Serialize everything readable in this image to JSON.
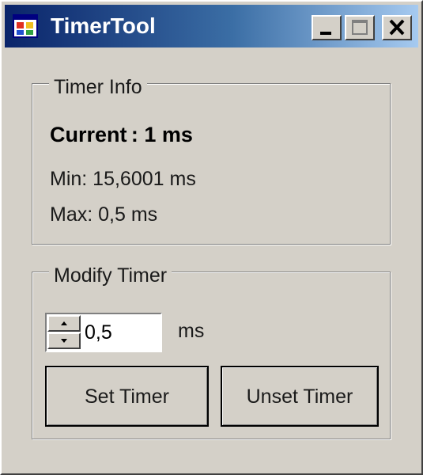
{
  "window": {
    "title": "TimerTool",
    "icon": "app-window-icon",
    "controls": [
      "minimize-icon",
      "maximize-icon",
      "close-icon"
    ]
  },
  "timer_info": {
    "legend": "Timer Info",
    "current": "Current :  1 ms",
    "min": "Min: 15,6001 ms",
    "max": "Max: 0,5 ms"
  },
  "modify_timer": {
    "legend": "Modify Timer",
    "spin_value": "0,5",
    "unit": "ms",
    "set_label": "Set Timer",
    "unset_label": "Unset Timer"
  },
  "colors": {
    "title_gradient_start": "#0a246a",
    "title_gradient_end": "#a6caf0",
    "face": "#d4d0c8"
  }
}
